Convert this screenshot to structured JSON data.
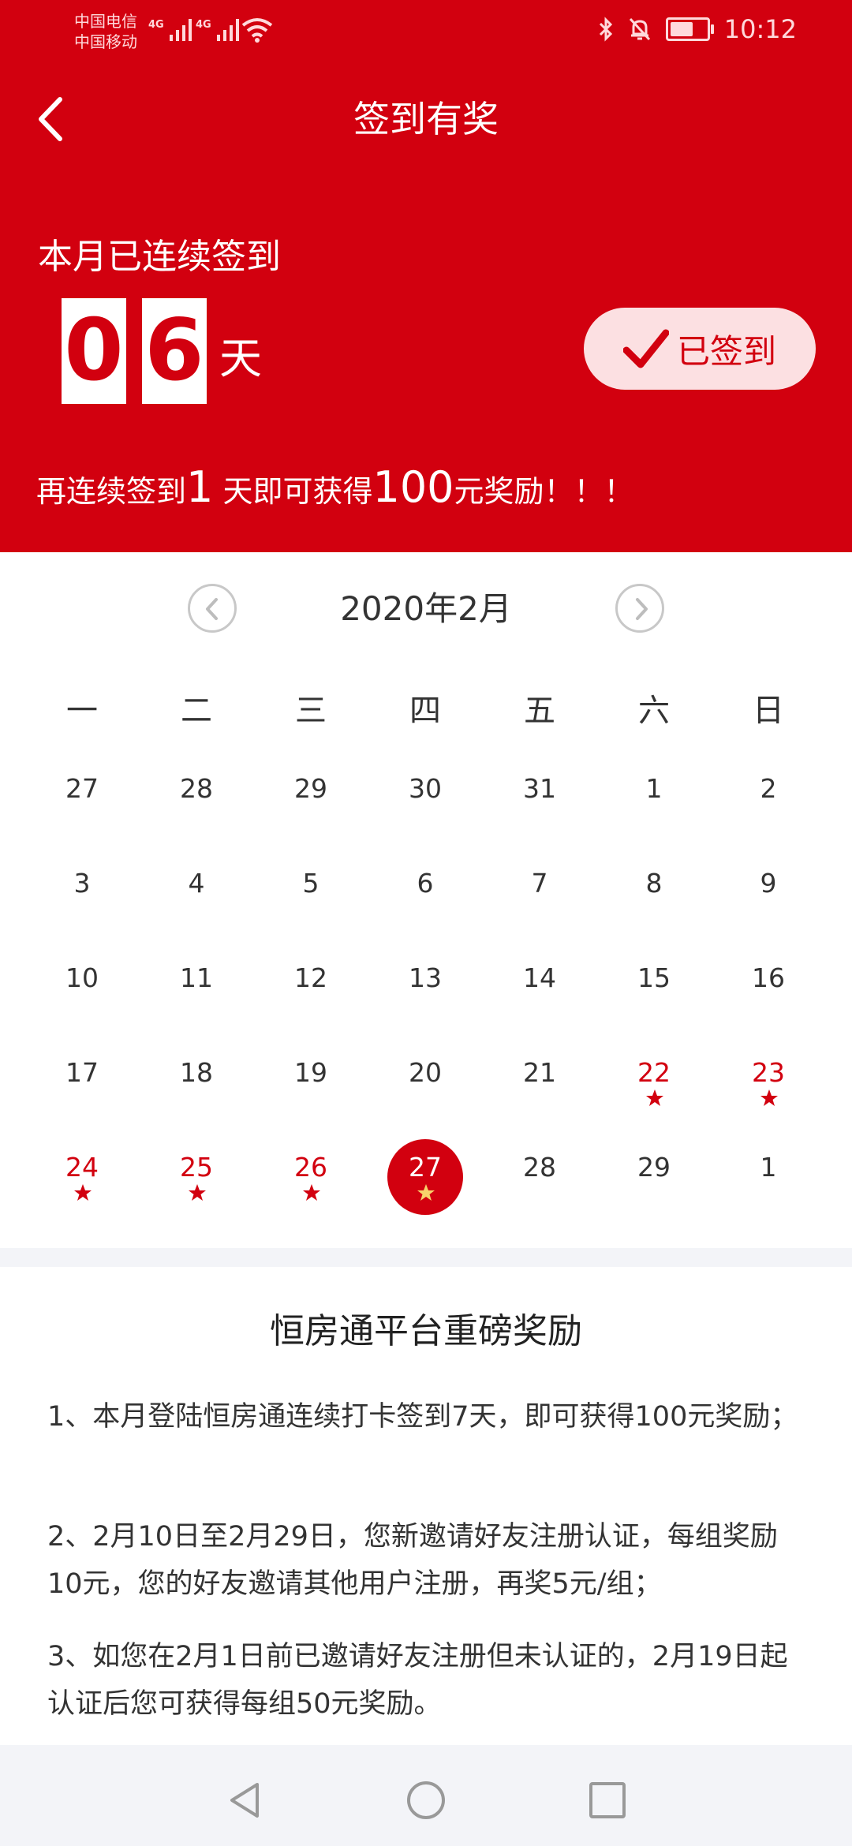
{
  "status_bar": {
    "carrier1": "中国电信",
    "carrier2": "中国移动",
    "network1": "4G",
    "network2": "4G",
    "time": "10:12"
  },
  "header": {
    "title": "签到有奖",
    "streak_label": "本月已连续签到",
    "streak_digit1": "0",
    "streak_digit2": "6",
    "streak_unit": "天",
    "signed_button": "已签到",
    "reward_tip": {
      "prefix": "再连续签到",
      "days": "1",
      "middle": " 天即可获得",
      "amount": "100",
      "suffix": "元奖励！！！"
    }
  },
  "calendar": {
    "month_title": "2020年2月",
    "weekdays": [
      "一",
      "二",
      "三",
      "四",
      "五",
      "六",
      "日"
    ],
    "weeks": [
      [
        "27",
        "28",
        "29",
        "30",
        "31",
        "1",
        "2"
      ],
      [
        "3",
        "4",
        "5",
        "6",
        "7",
        "8",
        "9"
      ],
      [
        "10",
        "11",
        "12",
        "13",
        "14",
        "15",
        "16"
      ],
      [
        "17",
        "18",
        "19",
        "20",
        "21",
        "22",
        "23"
      ],
      [
        "24",
        "25",
        "26",
        "27",
        "28",
        "29",
        "1"
      ]
    ],
    "checked_days": [
      "22",
      "23",
      "24",
      "25",
      "26"
    ],
    "today": "27"
  },
  "rules": {
    "title": "恒房通平台重磅奖励",
    "items": [
      "1、本月登陆恒房通连续打卡签到7天，即可获得100元奖励；",
      "2、2月10日至2月29日，您新邀请好友注册认证，每组奖励10元，您的好友邀请其他用户注册，再奖5元/组；",
      "3、如您在2月1日前已邀请好友注册但未认证的，2月19日起认证后您可获得每组50元奖励。"
    ]
  },
  "colors": {
    "accent": "#d2000f",
    "signed_bg": "#fce0e2",
    "star_today": "#f7d36b"
  }
}
